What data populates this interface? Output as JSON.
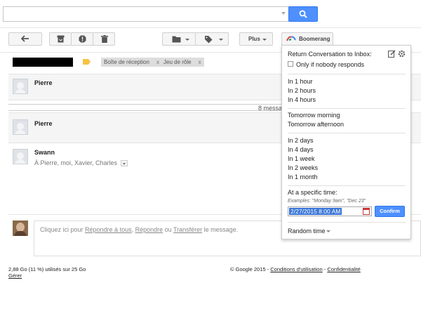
{
  "search": {
    "value": "",
    "placeholder": ""
  },
  "toolbar": {
    "more_label": "Plus",
    "boomerang_label": "Boomerang"
  },
  "labels": [
    {
      "name": "Boîte de réception",
      "remove": "x"
    },
    {
      "name": "Jeu de rôle",
      "remove": "x"
    }
  ],
  "messages": [
    {
      "sender": "Pierre"
    },
    {
      "sender": "Pierre"
    },
    {
      "sender": "Swann",
      "recipients": "À Pierre, moi, Xavier, Charles"
    }
  ],
  "collapsed": {
    "text": "8 messa"
  },
  "reply": {
    "prefix": "Cliquez ici pour ",
    "reply_all": "Répondre à tous",
    "sep1": ", ",
    "reply": "Répondre",
    "or": " ou ",
    "forward": "Transférer",
    "suffix": " le message."
  },
  "footer": {
    "storage": "2,88 Go (11 %) utilisés sur 25 Go",
    "manage": "Gérer",
    "copyright": "© Google 2015 - ",
    "terms": "Conditions d'utilisation",
    "dash": " - ",
    "privacy": "Confidentialité"
  },
  "boomerang": {
    "title": "Return Conversation to Inbox:",
    "only_if": "Only if nobody responds",
    "hours": [
      "In 1 hour",
      "In 2 hours",
      "In 4 hours"
    ],
    "tomorrow": [
      "Tomorrow morning",
      "Tomorrow afternoon"
    ],
    "days": [
      "In 2 days",
      "In 4 days",
      "In 1 week",
      "In 2 weeks",
      "In 1 month"
    ],
    "specific_label": "At a specific time:",
    "examples": "Examples: \"Monday 9am\", \"Dec 23\"",
    "date_value": "2/27/2015 8:00 AM",
    "confirm": "Confirm",
    "random_time": "Random time"
  },
  "colors": {
    "accent_blue": "#4d90fe",
    "label_tag": "#f6c344"
  },
  "icons": {
    "search": "search-icon",
    "back": "back-arrow-icon",
    "archive": "archive-icon",
    "spam": "report-spam-icon",
    "delete": "trash-icon",
    "move": "folder-icon",
    "labels": "label-tag-icon",
    "boomerang_logo": "boomerang-logo-icon",
    "edit": "edit-icon",
    "settings": "gear-icon"
  }
}
